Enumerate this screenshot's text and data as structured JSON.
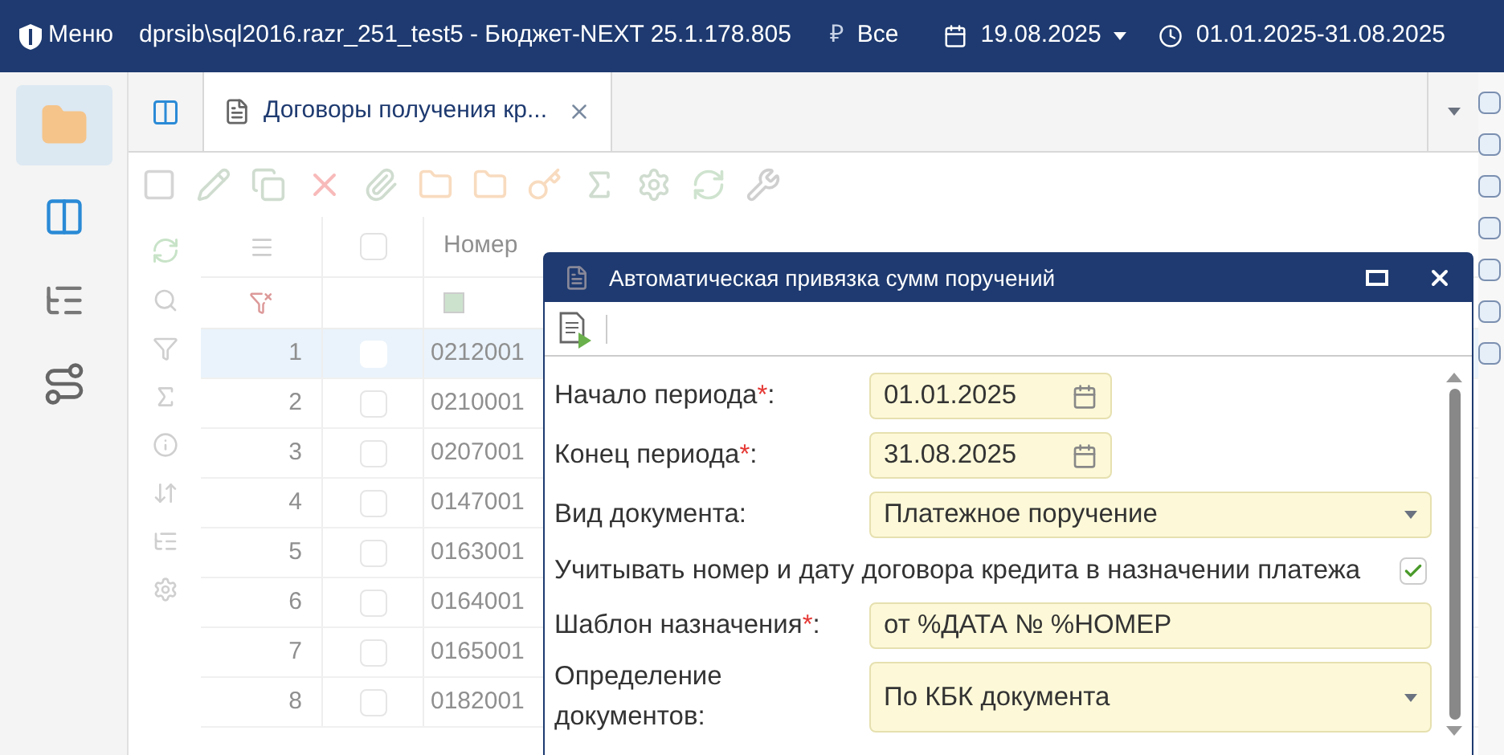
{
  "top_bar": {
    "menu": "Меню",
    "title": "dprsib\\sql2016.razr_251_test5 - Бюджет-NEXT 25.1.178.805",
    "currency_symbol": "₽",
    "currency": "Все",
    "date": "19.08.2025",
    "period": "01.01.2025-31.08.2025"
  },
  "tabs": [
    {
      "label": "Договоры получения кр...",
      "selected": true
    }
  ],
  "grid": {
    "columns": [
      "Номер"
    ],
    "all_checked": false,
    "rows": [
      {
        "num": "1",
        "number": "0212001",
        "selected": true
      },
      {
        "num": "2",
        "number": "0210001",
        "selected": false
      },
      {
        "num": "3",
        "number": "0207001",
        "selected": false
      },
      {
        "num": "4",
        "number": "0147001",
        "selected": false
      },
      {
        "num": "5",
        "number": "0163001",
        "selected": false
      },
      {
        "num": "6",
        "number": "0164001",
        "selected": false
      },
      {
        "num": "7",
        "number": "0165001",
        "selected": false
      },
      {
        "num": "8",
        "number": "0182001",
        "selected": false
      }
    ]
  },
  "dialog": {
    "title": "Автоматическая привязка сумм поручений",
    "fields": [
      {
        "kind": "date",
        "label": "Начало периода",
        "required_mark": "*",
        "colon": ":",
        "value": "01.01.2025"
      },
      {
        "kind": "date",
        "label": "Конец периода",
        "required_mark": "*",
        "colon": ":",
        "value": "31.08.2025"
      },
      {
        "kind": "select",
        "label": "Вид документа:",
        "value": "Платежное поручение"
      },
      {
        "kind": "checkbox",
        "label": "Учитывать номер и дату договора кредита в назначении платежа",
        "checked": true
      },
      {
        "kind": "text",
        "label": "Шаблон назначения",
        "required_mark": "*",
        "colon": ":",
        "value": "от %ДАТА № %НОМЕР"
      },
      {
        "kind": "select",
        "label": "Определение документов:",
        "value": "По КБК документа"
      }
    ]
  }
}
